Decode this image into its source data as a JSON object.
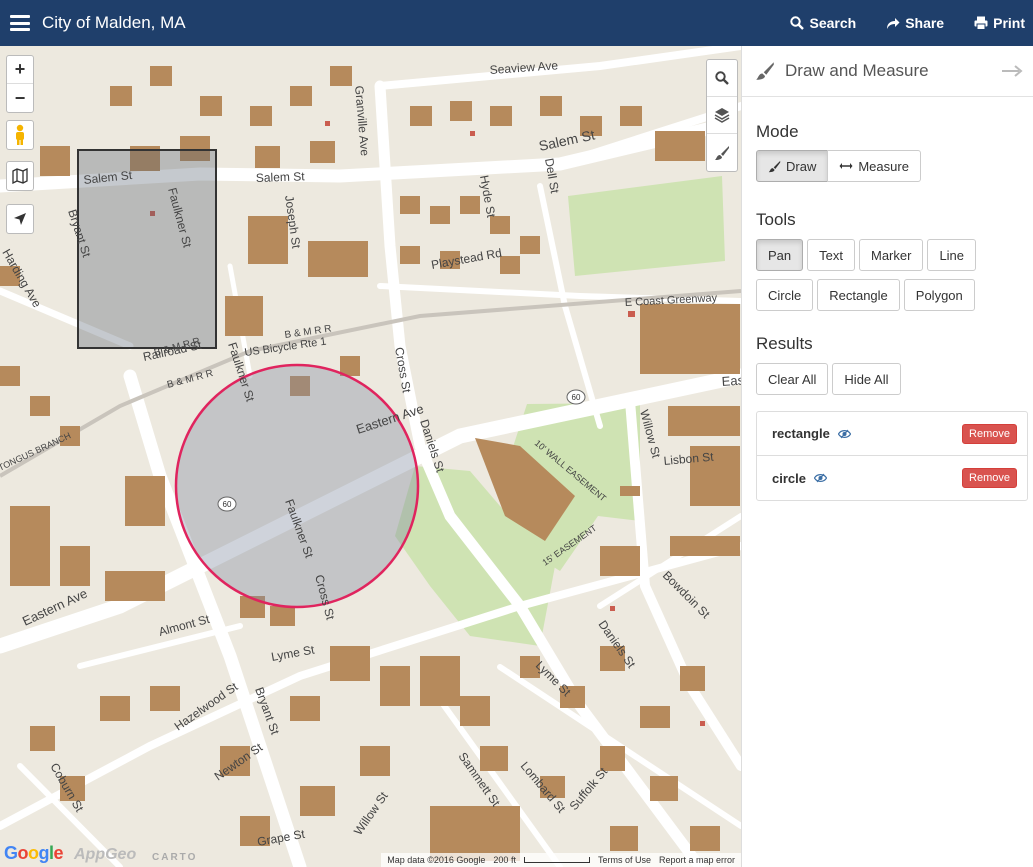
{
  "header": {
    "title": "City of Malden, MA",
    "search_label": "Search",
    "share_label": "Share",
    "print_label": "Print"
  },
  "map": {
    "zoom_in": "+",
    "zoom_out": "−",
    "street_labels": {
      "seaview": "Seaview Ave",
      "salem_e": "Salem St",
      "salem_w": "Salem St",
      "salem_far": "Salem St",
      "granville": "Granville Ave",
      "joseph": "Joseph St",
      "faulkner_n": "Faulkner St",
      "faulkner_s": "Faulkner St",
      "faulkner_mid": "Faulkner St",
      "bryant_n": "Bryant St",
      "bryant_s": "Bryant St",
      "hyde": "Hyde St",
      "dell": "Dell St",
      "playstead": "Playstead Rd",
      "coast_greenway": "E Coast Greenway",
      "bmrr_1": "B & M R R",
      "bmrr_2": "B & M R R",
      "bmrr_3": "B & M R R",
      "railroad": "Railroad St",
      "bicycle": "US Bicycle Rte 1",
      "cross_n": "Cross St",
      "cross_s": "Cross St",
      "eastern_e": "Eastern Ave",
      "eastern_w": "Eastern Ave",
      "eastern_far": "Eastern Ave",
      "daniels_n": "Daniels St",
      "daniels_s": "Daniels St",
      "willow_n": "Willow St",
      "willow_s": "Willow St",
      "lisbon": "Lisbon St",
      "wall_easement": "10' WALL EASEMENT",
      "easement_15": "15' EASEMENT",
      "bowdoin": "Bowdoin St",
      "harding": "Harding Ave",
      "tongus": "TONGUS BRANCH",
      "almont": "Almont St",
      "lyme_w": "Lyme St",
      "lyme_e": "Lyme St",
      "hazelwood": "Hazelwood St",
      "newton": "Newton St",
      "coburn": "Coburn St",
      "grape": "Grape St",
      "sammett": "Sammett St",
      "lombard": "Lombard St",
      "suffolk": "Suffolk St",
      "route_60": "60"
    },
    "attribution": {
      "map_data": "Map data ©2016 Google",
      "scale": "200 ft",
      "terms": "Terms of Use",
      "report": "Report a map error"
    },
    "logos": {
      "google": [
        "G",
        "o",
        "o",
        "g",
        "l",
        "e"
      ],
      "appgeo": "AppGeo",
      "carto": "CARTO"
    }
  },
  "panel": {
    "title": "Draw and Measure",
    "mode_title": "Mode",
    "mode_draw": "Draw",
    "mode_measure": "Measure",
    "tools_title": "Tools",
    "tools": {
      "pan": "Pan",
      "text": "Text",
      "marker": "Marker",
      "line": "Line",
      "circle": "Circle",
      "rectangle": "Rectangle",
      "polygon": "Polygon"
    },
    "results_title": "Results",
    "clear_all": "Clear All",
    "hide_all": "Hide All",
    "results": [
      {
        "name": "rectangle",
        "remove": "Remove"
      },
      {
        "name": "circle",
        "remove": "Remove"
      }
    ]
  },
  "colors": {
    "header_bg": "#1f3f6b",
    "map_bg": "#ede9df",
    "building": "#b68a5c",
    "park": "#cfe3b3",
    "remove": "#d9534f",
    "circle_stroke": "#e0245e",
    "rect_stroke": "#333333"
  }
}
